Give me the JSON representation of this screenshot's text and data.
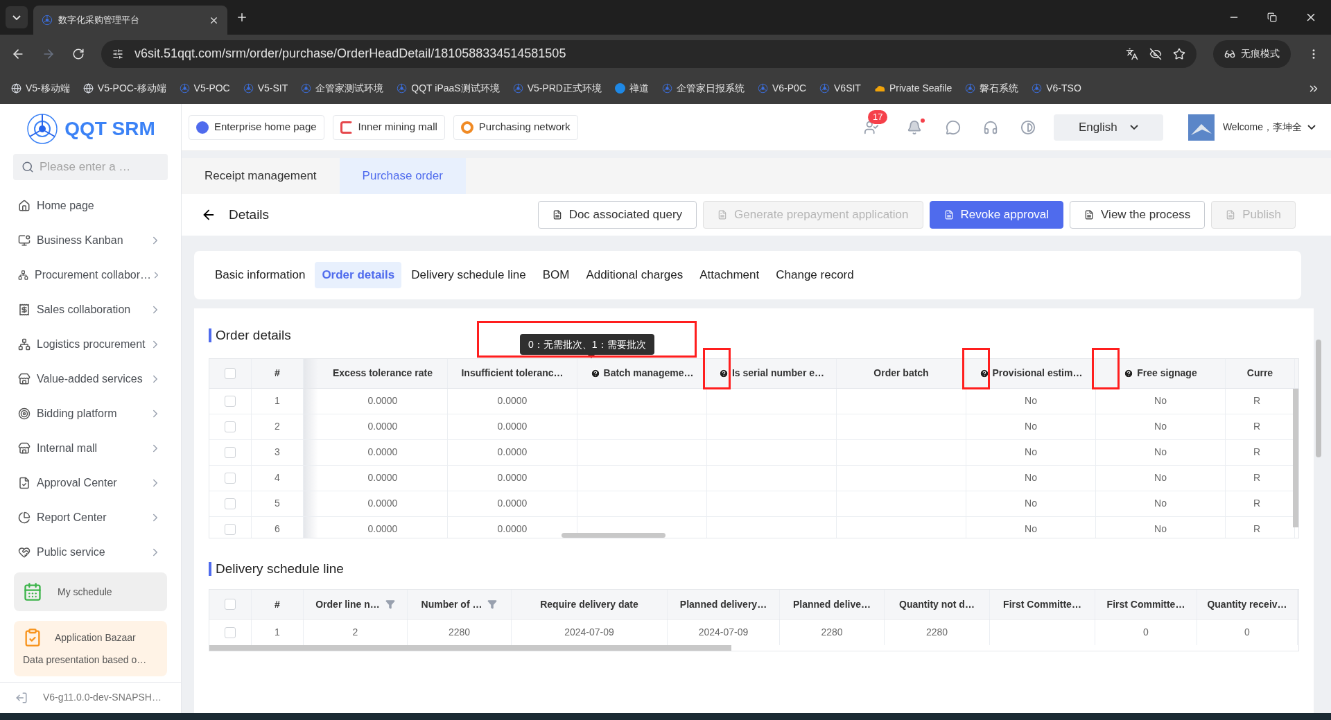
{
  "browser": {
    "tabs": [
      {
        "title": "数字化采购管理平台",
        "selected": true
      }
    ],
    "url": "v6sit.51qqt.com/srm/order/purchase/OrderHeadDetail/1810588334514581505",
    "incognito": "无痕模式",
    "bookmarks": [
      "V5-移动端",
      "V5-POC-移动端",
      "V5-POC",
      "V5-SIT",
      "企管家测试环境",
      "QQT iPaaS测试环境",
      "V5-PRD正式环境",
      "禅道",
      "企管家日报系统",
      "V6-P0C",
      "V6SIT",
      "Private Seafile",
      "磐石系统",
      "V6-TSO"
    ]
  },
  "sidebar": {
    "logo": "QQT SRM",
    "search": {
      "placeholder": "Please enter a …"
    },
    "items": [
      {
        "label": "Home page",
        "arrow": false
      },
      {
        "label": "Business Kanban",
        "arrow": true
      },
      {
        "label": "Procurement collabor…",
        "arrow": true
      },
      {
        "label": "Sales collaboration",
        "arrow": true
      },
      {
        "label": "Logistics procurement",
        "arrow": true
      },
      {
        "label": "Value-added services",
        "arrow": true
      },
      {
        "label": "Bidding platform",
        "arrow": true
      },
      {
        "label": "Internal mall",
        "arrow": true
      },
      {
        "label": "Approval Center",
        "arrow": true
      },
      {
        "label": "Report Center",
        "arrow": true
      },
      {
        "label": "Public service",
        "arrow": true
      }
    ],
    "schedule": "My schedule",
    "bazaar": {
      "title": "Application Bazaar",
      "description": "Data presentation based o…"
    },
    "version": "V6-g11.0.0-dev-SNAPSH…"
  },
  "header": {
    "links": [
      "Enterprise home page",
      "Inner mining mall",
      "Purchasing network"
    ],
    "notification_count": "17",
    "language": "English",
    "welcome": "Welcome，李坤全"
  },
  "page_tabs": [
    {
      "label": "Receipt management",
      "selected": false
    },
    {
      "label": "Purchase order",
      "selected": true
    }
  ],
  "details": {
    "title": "Details",
    "buttons": [
      {
        "label": "Doc associated query",
        "kind": "default"
      },
      {
        "label": "Generate prepayment application",
        "kind": "disabled"
      },
      {
        "label": "Revoke approval",
        "kind": "primary"
      },
      {
        "label": "View the process",
        "kind": "default"
      },
      {
        "label": "Publish",
        "kind": "disabled"
      }
    ]
  },
  "section_tabs": [
    {
      "label": "Basic information",
      "selected": false
    },
    {
      "label": "Order details",
      "selected": true
    },
    {
      "label": "Delivery schedule line",
      "selected": false
    },
    {
      "label": "BOM",
      "selected": false
    },
    {
      "label": "Additional charges",
      "selected": false
    },
    {
      "label": "Attachment",
      "selected": false
    },
    {
      "label": "Change record",
      "selected": false
    }
  ],
  "order_details": {
    "title": "Order details",
    "tooltip": "0：无需批次、1：需要批次",
    "all_checked": false,
    "columns": [
      {
        "label": "#",
        "help": false,
        "highlighted": false
      },
      {
        "label": "Excess tolerance rate",
        "help": false,
        "highlighted": false
      },
      {
        "label": "Insufficient toleranc…",
        "help": false,
        "highlighted": false
      },
      {
        "label": "Batch manageme…",
        "help": true,
        "highlighted": false
      },
      {
        "label": "Is serial number e…",
        "help": true,
        "highlighted": true
      },
      {
        "label": "Order batch",
        "help": false,
        "highlighted": false
      },
      {
        "label": "Provisional estim…",
        "help": true,
        "highlighted": true
      },
      {
        "label": "Free signage",
        "help": true,
        "highlighted": true
      },
      {
        "label": "Curre",
        "help": false,
        "highlighted": false
      }
    ],
    "rows": [
      {
        "checked": false,
        "cells": [
          "1",
          "0.0000",
          "0.0000",
          "",
          "",
          "",
          "No",
          "No",
          "R"
        ]
      },
      {
        "checked": false,
        "cells": [
          "2",
          "0.0000",
          "0.0000",
          "",
          "",
          "",
          "No",
          "No",
          "R"
        ]
      },
      {
        "checked": false,
        "cells": [
          "3",
          "0.0000",
          "0.0000",
          "",
          "",
          "",
          "No",
          "No",
          "R"
        ]
      },
      {
        "checked": false,
        "cells": [
          "4",
          "0.0000",
          "0.0000",
          "",
          "",
          "",
          "No",
          "No",
          "R"
        ]
      },
      {
        "checked": false,
        "cells": [
          "5",
          "0.0000",
          "0.0000",
          "",
          "",
          "",
          "No",
          "No",
          "R"
        ]
      },
      {
        "checked": false,
        "cells": [
          "6",
          "0.0000",
          "0.0000",
          "",
          "",
          "",
          "No",
          "No",
          "R"
        ]
      }
    ]
  },
  "delivery": {
    "title": "Delivery schedule line",
    "all_checked": false,
    "columns": [
      {
        "label": "#",
        "filter": false
      },
      {
        "label": "Order line n…",
        "filter": true
      },
      {
        "label": "Number of …",
        "filter": true
      },
      {
        "label": "Require delivery date",
        "filter": false
      },
      {
        "label": "Planned delivery…",
        "filter": false
      },
      {
        "label": "Planned delive…",
        "filter": false
      },
      {
        "label": "Quantity not d…",
        "filter": false
      },
      {
        "label": "First Committe…",
        "filter": false
      },
      {
        "label": "First Committe…",
        "filter": false
      },
      {
        "label": "Quantity receiv…",
        "filter": false
      }
    ],
    "rows": [
      {
        "checked": false,
        "cells": [
          "1",
          "2",
          "2280",
          "2024-07-09",
          "2024-07-09",
          "2280",
          "2280",
          "",
          "0",
          "0"
        ]
      }
    ]
  }
}
